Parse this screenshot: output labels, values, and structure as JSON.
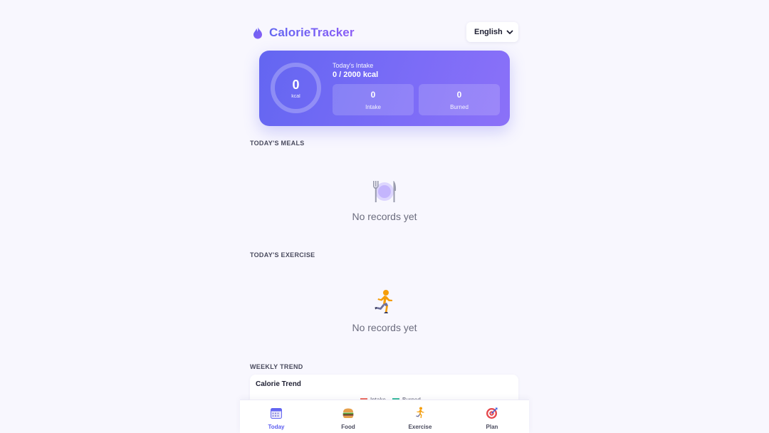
{
  "app": {
    "title_part1": "Calorie",
    "title_part2": "Tracker",
    "accent": "#6366f1"
  },
  "header": {
    "language": {
      "selected": "English"
    }
  },
  "summary": {
    "ring_value": "0",
    "ring_unit": "kcal",
    "intake_title": "Today's Intake",
    "intake_value": "0 / 2000 kcal",
    "stats": {
      "intake": {
        "value": "0",
        "label": "Intake"
      },
      "burned": {
        "value": "0",
        "label": "Burned"
      }
    }
  },
  "meals": {
    "title": "TODAY'S MEALS",
    "empty_icon": "plate-fork-knife-icon",
    "empty_text": "No records yet"
  },
  "exercise": {
    "title": "TODAY'S EXERCISE",
    "empty_icon": "running-person-icon",
    "empty_text": "No records yet"
  },
  "weekly": {
    "title": "WEEKLY TREND",
    "chart_title": "Calorie Trend",
    "legend": [
      {
        "label": "Intake",
        "color": "#f07064"
      },
      {
        "label": "Burned",
        "color": "#3cbfa0"
      }
    ]
  },
  "nav": {
    "items": [
      {
        "label": "Today",
        "icon": "calendar-icon",
        "active": true
      },
      {
        "label": "Food",
        "icon": "burger-icon",
        "active": false
      },
      {
        "label": "Exercise",
        "icon": "running-person-icon",
        "active": false
      },
      {
        "label": "Plan",
        "icon": "target-icon",
        "active": false
      }
    ]
  }
}
